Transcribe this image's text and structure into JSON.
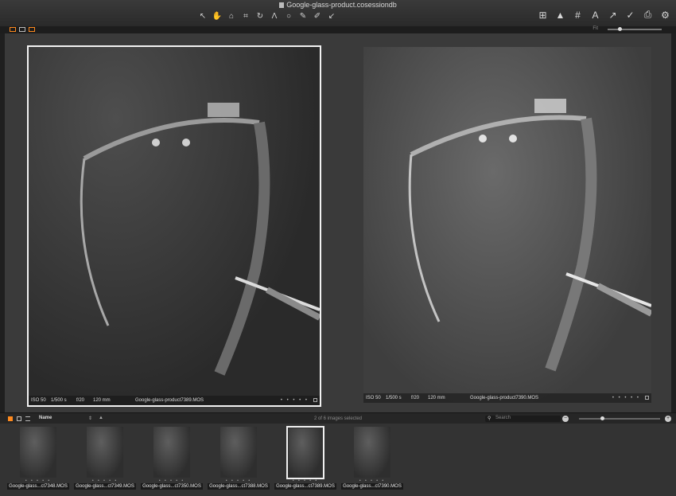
{
  "window": {
    "title": "Google-glass-product.cosessiondb"
  },
  "toolbar": {
    "left_tools": [
      {
        "name": "select-tool",
        "glyph": "↖"
      },
      {
        "name": "pan-tool",
        "glyph": "✋",
        "active": true
      },
      {
        "name": "loupe-tool",
        "glyph": "⌂"
      },
      {
        "name": "crop-tool",
        "glyph": "⌗"
      },
      {
        "name": "rotate-tool",
        "glyph": "↻"
      },
      {
        "name": "keystone-tool",
        "glyph": "Λ"
      },
      {
        "name": "spot-removal-tool",
        "glyph": "○"
      },
      {
        "name": "color-picker-tool",
        "glyph": "✎"
      },
      {
        "name": "brush-tool",
        "glyph": "✐"
      },
      {
        "name": "annotation-tool",
        "glyph": "↙"
      }
    ],
    "right_tools": [
      {
        "name": "grid-view-icon",
        "glyph": "⊞"
      },
      {
        "name": "warning-icon",
        "glyph": "▲"
      },
      {
        "name": "guides-icon",
        "glyph": "#"
      },
      {
        "name": "text-overlay-icon",
        "glyph": "A"
      },
      {
        "name": "cursor-icon",
        "glyph": "↗"
      },
      {
        "name": "check-icon",
        "glyph": "✓"
      },
      {
        "name": "print-icon",
        "glyph": "⎙"
      },
      {
        "name": "settings-icon",
        "glyph": "⚙"
      }
    ],
    "zoom_label": "Fit"
  },
  "viewer": {
    "images": [
      {
        "iso": "ISO 50",
        "shutter": "1/500 s",
        "aperture": "f/20",
        "focal": "120 mm",
        "filename": "Google-glass-product7389.MOS",
        "dots": "• • • • •"
      },
      {
        "iso": "ISO 50",
        "shutter": "1/500 s",
        "aperture": "f/20",
        "focal": "120 mm",
        "filename": "Google-glass-product7390.MOS",
        "dots": "• • • • •"
      }
    ]
  },
  "browser": {
    "sort_label": "Name",
    "sort_arrows": "⇕",
    "sort_direction": "▲",
    "selection_status": "2 of 6 images selected",
    "search_placeholder": "Search",
    "search_icon": "⚲",
    "zoom_out": "−",
    "zoom_in": "+"
  },
  "filmstrip": [
    {
      "label": "Google-glass...ct7348.MOS",
      "selected": false
    },
    {
      "label": "Google-glass...ct7349.MOS",
      "selected": false
    },
    {
      "label": "Google-glass...ct7350.MOS",
      "selected": false
    },
    {
      "label": "Google-glass...ct7388.MOS",
      "selected": false
    },
    {
      "label": "Google-glass...ct7389.MOS",
      "selected": true
    },
    {
      "label": "Google-glass...ct7390.MOS",
      "selected": false
    }
  ],
  "colors": {
    "accent": "#ff8a1e",
    "selection_border": "#f2f2f2"
  }
}
